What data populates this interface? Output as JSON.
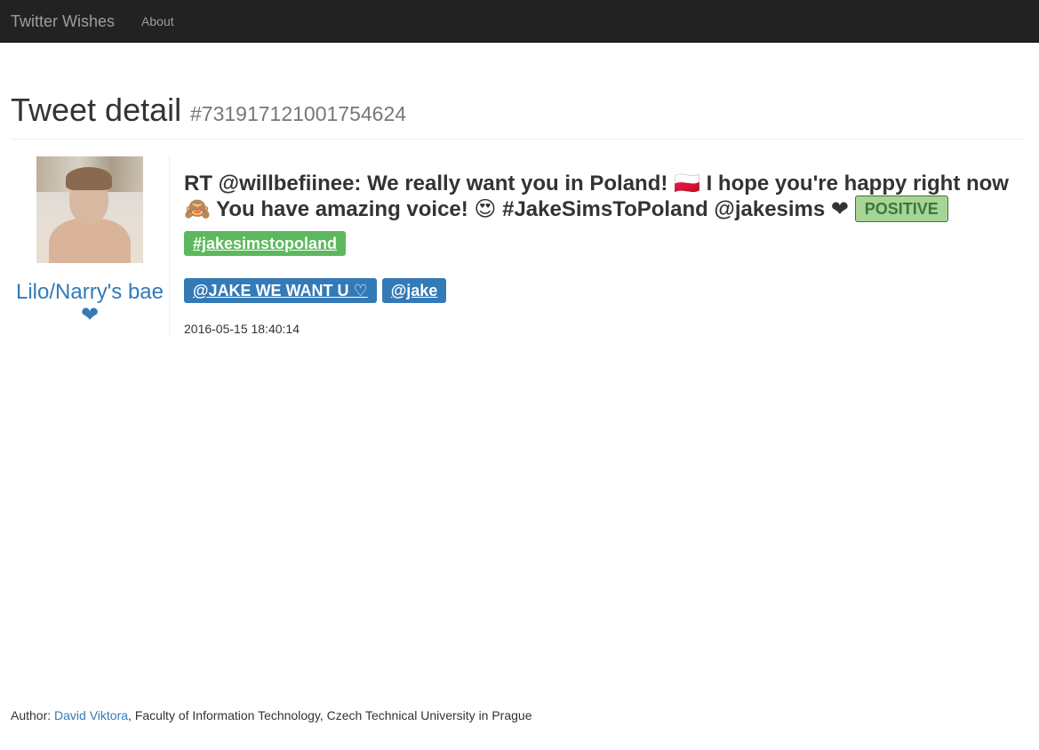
{
  "navbar": {
    "brand": "Twitter Wishes",
    "about_link": "About",
    "background": "#222222"
  },
  "header": {
    "title": "Tweet detail",
    "tweet_id": "#731917121001754624"
  },
  "author": {
    "avatar_icon": "profile-photo",
    "name": "Lilo/Narry's bae ❤"
  },
  "tweet": {
    "text": "RT @willbefiinee: We really want you in Poland! 🇵🇱 I hope you're happy right now🙈 You have amazing voice! 😍 #JakeSimsToPoland @jakesims ❤",
    "sentiment": "POSITIVE",
    "hashtags": [
      "#jakesimstopoland"
    ],
    "mentions": [
      "@JAKE WE WANT U ♡",
      "@jake"
    ],
    "timestamp": "2016-05-15 18:40:14"
  },
  "footer": {
    "prefix": "Author: ",
    "author_link": "David Viktora",
    "suffix": ", Faculty of Information Technology, Czech Technical University in Prague"
  },
  "colors": {
    "link": "#337ab7",
    "hashtag_label": "#5cb85c",
    "mention_label": "#337ab7",
    "sentiment_bg": "#a6d595",
    "sentiment_text": "#3c763d"
  }
}
